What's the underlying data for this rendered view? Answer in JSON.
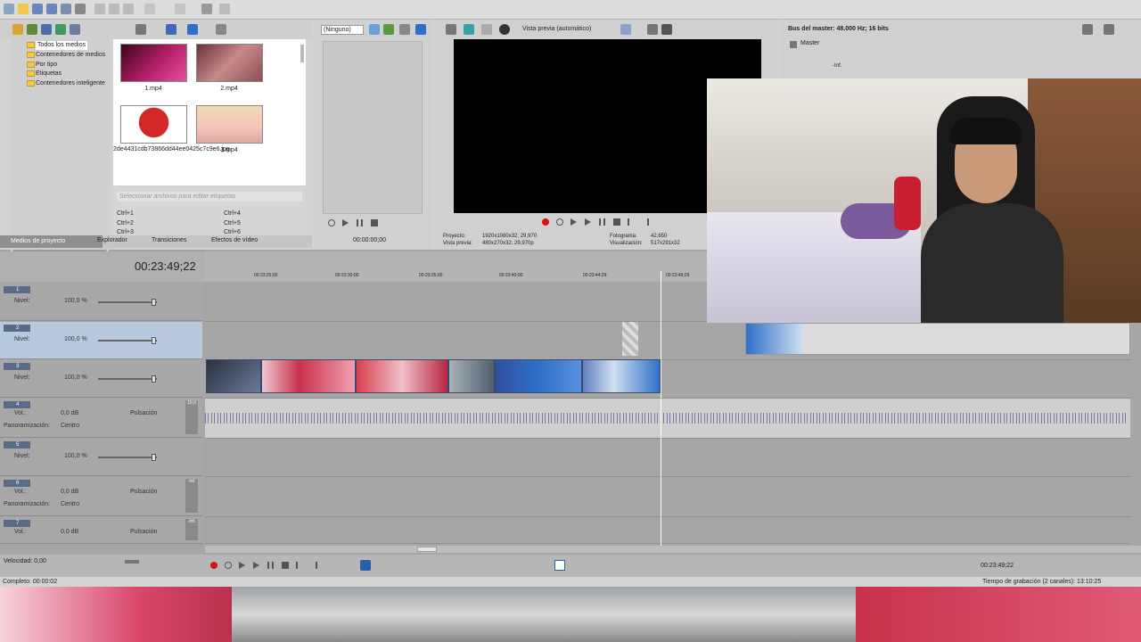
{
  "explorer": {
    "tree": [
      "Todos los medios",
      "Contenedores de medios",
      "Por tipo",
      "Etiquetas",
      "Contenedores inteligente"
    ],
    "media": [
      {
        "caption": "1.mp4"
      },
      {
        "caption": "2.mp4"
      },
      {
        "caption": "2de4431cdb73866dd44ee0425c7c9e6.jpg"
      },
      {
        "caption": "3.mp4"
      }
    ],
    "tag_placeholder": "Seleccionar archivos para editar etiquetas",
    "shortcuts": [
      "Ctrl+1",
      "Ctrl+2",
      "Ctrl+3",
      "Ctrl+4",
      "Ctrl+5",
      "Ctrl+6"
    ]
  },
  "tabs": [
    "Medios de proyecto",
    "Explorador",
    "Transiciones",
    "Efectos de vídeo"
  ],
  "trimmer": {
    "select": "(Ninguno)",
    "time": "00:00:00;00"
  },
  "preview": {
    "mode": "Vista previa (automático)",
    "proyecto_label": "Proyecto:",
    "proyecto": "1920x1080x32; 29,970",
    "vista_label": "Vista previa:",
    "vista": "480x270x32; 29,970p",
    "fotograma_label": "Fotograma:",
    "fotograma": "42.650",
    "visual_label": "Visualización:",
    "visual": "517x291x32"
  },
  "master": {
    "title": "Bus del master: 48.000 Hz; 16 bits",
    "label": "Master",
    "inf": "-Inf."
  },
  "timeline": {
    "timecode": "00:23:49;22",
    "ruler": [
      "00:23:25;00",
      "00:23:30;00",
      "00:23:35;00",
      "00:23:40;00",
      "00:23:44;29",
      "00:23:49;29"
    ]
  },
  "tracks": [
    {
      "num": "1",
      "label": "Nivel:",
      "value": "100,0 %"
    },
    {
      "num": "2",
      "label": "Nivel:",
      "value": "100,0 %"
    },
    {
      "num": "3",
      "label": "Nivel:",
      "value": "100,0 %"
    },
    {
      "num": "4",
      "vol_label": "Vol.:",
      "vol": "0,0 dB",
      "pan_label": "Panoramización:",
      "pan": "Centro",
      "mode": "Pulsación",
      "meter": "15,0"
    },
    {
      "num": "5",
      "label": "Nivel:",
      "value": "100,0 %"
    },
    {
      "num": "6",
      "vol_label": "Vol.:",
      "vol": "0,0 dB",
      "pan_label": "Panoramización:",
      "pan": "Centro",
      "mode": "Pulsación",
      "meter": "-Inf."
    },
    {
      "num": "7",
      "vol_label": "Vol.:",
      "vol": "0,0 dB",
      "mode": "Pulsación",
      "meter": "-Inf."
    }
  ],
  "transport": {
    "rate_label": "Velocidad: 0,00",
    "time_right": "00:23:49;22"
  },
  "status": {
    "left": "Completo: 00:00:02",
    "right": "Tiempo de grabación (2 canales): 13:10:25"
  },
  "colors": {
    "accent": "#2c5ea8",
    "audio_wave": "#4a3a8a",
    "clip_anime_red": "#c8324a",
    "clip_blue": "#2f6fc8"
  }
}
